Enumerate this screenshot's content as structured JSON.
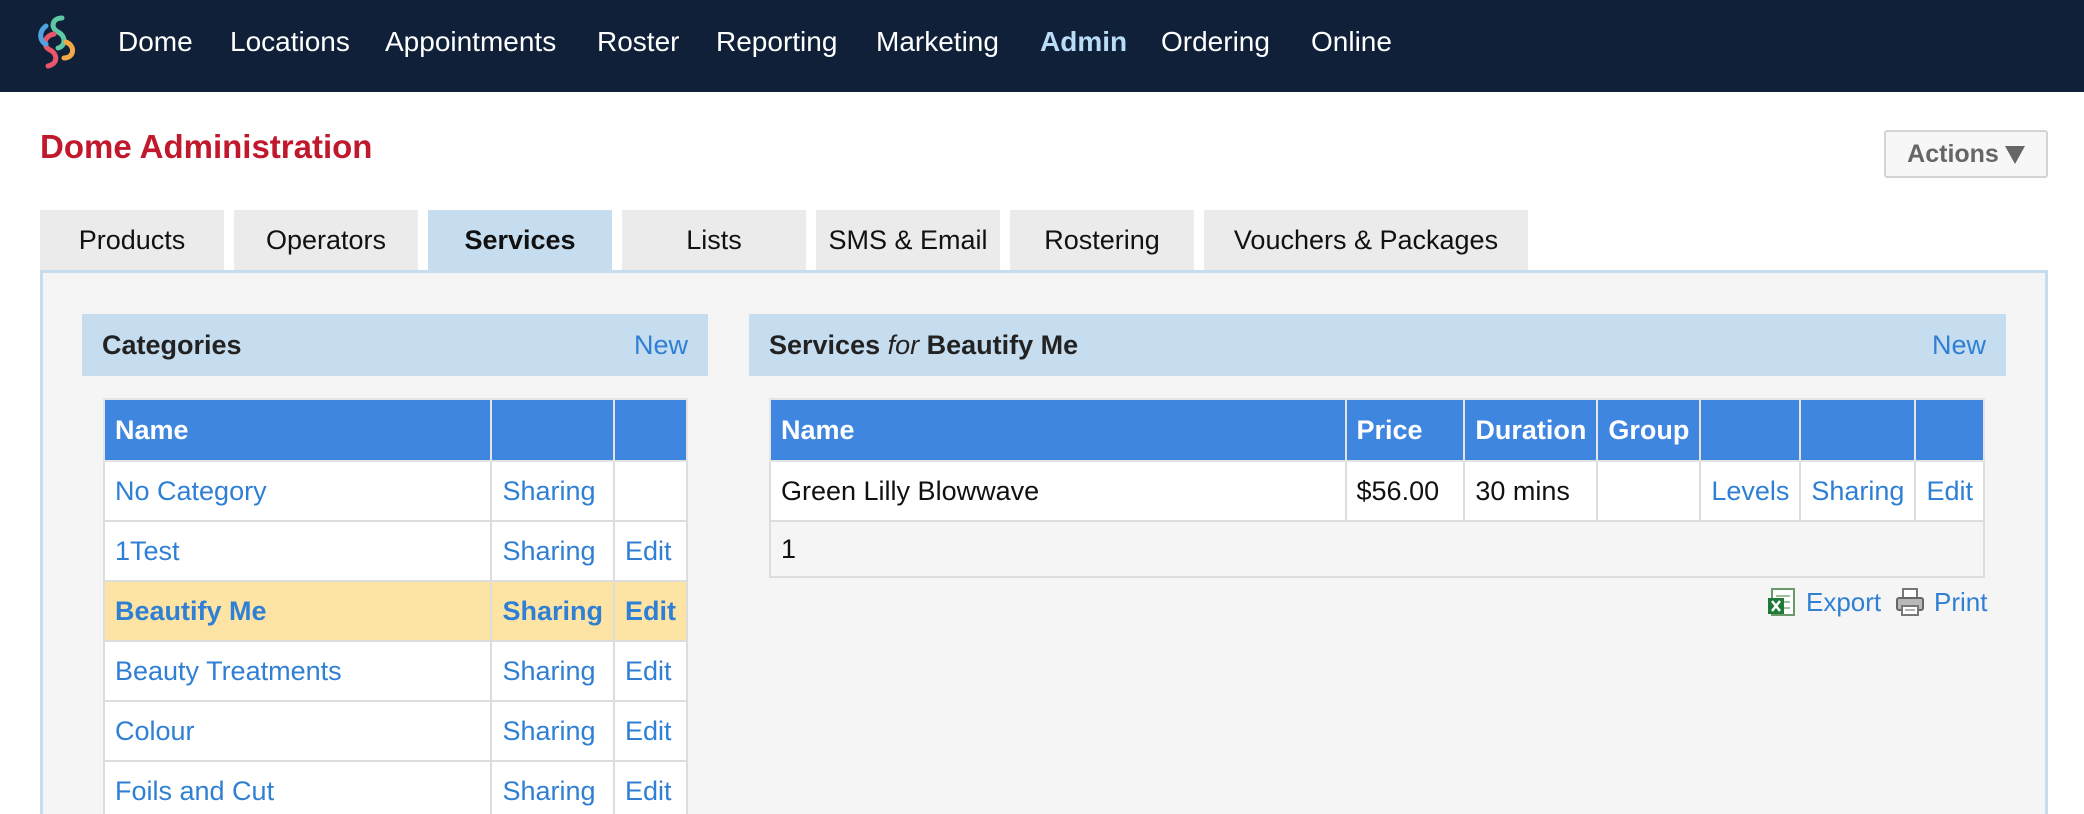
{
  "nav": {
    "items": [
      {
        "label": "Dome",
        "active": false
      },
      {
        "label": "Locations",
        "active": false
      },
      {
        "label": "Appointments",
        "active": false
      },
      {
        "label": "Roster",
        "active": false
      },
      {
        "label": "Reporting",
        "active": false
      },
      {
        "label": "Marketing",
        "active": false
      },
      {
        "label": "Admin",
        "active": true
      },
      {
        "label": "Ordering",
        "active": false
      },
      {
        "label": "Online",
        "active": false
      }
    ]
  },
  "page": {
    "title": "Dome Administration",
    "actions_label": "Actions"
  },
  "tabs": [
    {
      "label": "Products",
      "active": false
    },
    {
      "label": "Operators",
      "active": false
    },
    {
      "label": "Services",
      "active": true
    },
    {
      "label": "Lists",
      "active": false
    },
    {
      "label": "SMS & Email",
      "active": false
    },
    {
      "label": "Rostering",
      "active": false
    },
    {
      "label": "Vouchers & Packages",
      "active": false
    }
  ],
  "categories": {
    "title": "Categories",
    "new_label": "New",
    "columns": [
      "Name",
      "",
      ""
    ],
    "rows": [
      {
        "name": "No Category",
        "sharing": "Sharing",
        "edit": ""
      },
      {
        "name": "1Test",
        "sharing": "Sharing",
        "edit": "Edit"
      },
      {
        "name": "Beautify Me",
        "sharing": "Sharing",
        "edit": "Edit",
        "selected": true
      },
      {
        "name": "Beauty Treatments",
        "sharing": "Sharing",
        "edit": "Edit"
      },
      {
        "name": "Colour",
        "sharing": "Sharing",
        "edit": "Edit"
      },
      {
        "name": "Foils and Cut",
        "sharing": "Sharing",
        "edit": "Edit"
      }
    ]
  },
  "services": {
    "title_prefix": "Services",
    "title_for": "for",
    "title_category": "Beautify Me",
    "new_label": "New",
    "columns": [
      "Name",
      "Price",
      "Duration",
      "Group",
      "",
      "",
      ""
    ],
    "rows": [
      {
        "name": "Green Lilly Blowwave",
        "price": "$56.00",
        "duration": "30 mins",
        "group": "",
        "levels": "Levels",
        "sharing": "Sharing",
        "edit": "Edit"
      }
    ],
    "pager": "1",
    "export_label": "Export",
    "print_label": "Print"
  },
  "colors": {
    "nav_bg": "#0f2038",
    "title_red": "#c0182c",
    "table_header_blue": "#3f86e0",
    "panel_header": "#c6ddef",
    "link_blue": "#2f7fd4",
    "selected_row": "#fde4a5"
  }
}
